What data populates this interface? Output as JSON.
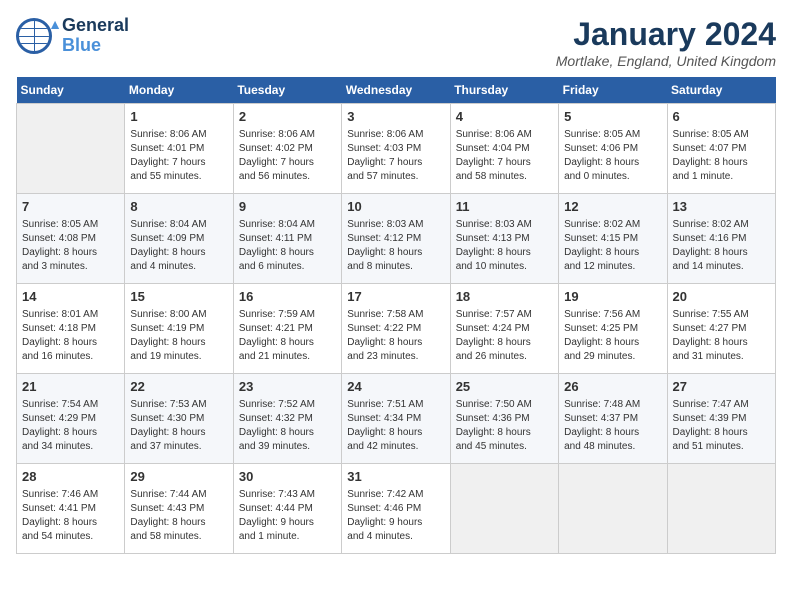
{
  "logo": {
    "general": "General",
    "blue": "Blue"
  },
  "header": {
    "title": "January 2024",
    "location": "Mortlake, England, United Kingdom"
  },
  "weekdays": [
    "Sunday",
    "Monday",
    "Tuesday",
    "Wednesday",
    "Thursday",
    "Friday",
    "Saturday"
  ],
  "weeks": [
    [
      {
        "day": "",
        "info": ""
      },
      {
        "day": "1",
        "info": "Sunrise: 8:06 AM\nSunset: 4:01 PM\nDaylight: 7 hours\nand 55 minutes."
      },
      {
        "day": "2",
        "info": "Sunrise: 8:06 AM\nSunset: 4:02 PM\nDaylight: 7 hours\nand 56 minutes."
      },
      {
        "day": "3",
        "info": "Sunrise: 8:06 AM\nSunset: 4:03 PM\nDaylight: 7 hours\nand 57 minutes."
      },
      {
        "day": "4",
        "info": "Sunrise: 8:06 AM\nSunset: 4:04 PM\nDaylight: 7 hours\nand 58 minutes."
      },
      {
        "day": "5",
        "info": "Sunrise: 8:05 AM\nSunset: 4:06 PM\nDaylight: 8 hours\nand 0 minutes."
      },
      {
        "day": "6",
        "info": "Sunrise: 8:05 AM\nSunset: 4:07 PM\nDaylight: 8 hours\nand 1 minute."
      }
    ],
    [
      {
        "day": "7",
        "info": "Sunrise: 8:05 AM\nSunset: 4:08 PM\nDaylight: 8 hours\nand 3 minutes."
      },
      {
        "day": "8",
        "info": "Sunrise: 8:04 AM\nSunset: 4:09 PM\nDaylight: 8 hours\nand 4 minutes."
      },
      {
        "day": "9",
        "info": "Sunrise: 8:04 AM\nSunset: 4:11 PM\nDaylight: 8 hours\nand 6 minutes."
      },
      {
        "day": "10",
        "info": "Sunrise: 8:03 AM\nSunset: 4:12 PM\nDaylight: 8 hours\nand 8 minutes."
      },
      {
        "day": "11",
        "info": "Sunrise: 8:03 AM\nSunset: 4:13 PM\nDaylight: 8 hours\nand 10 minutes."
      },
      {
        "day": "12",
        "info": "Sunrise: 8:02 AM\nSunset: 4:15 PM\nDaylight: 8 hours\nand 12 minutes."
      },
      {
        "day": "13",
        "info": "Sunrise: 8:02 AM\nSunset: 4:16 PM\nDaylight: 8 hours\nand 14 minutes."
      }
    ],
    [
      {
        "day": "14",
        "info": "Sunrise: 8:01 AM\nSunset: 4:18 PM\nDaylight: 8 hours\nand 16 minutes."
      },
      {
        "day": "15",
        "info": "Sunrise: 8:00 AM\nSunset: 4:19 PM\nDaylight: 8 hours\nand 19 minutes."
      },
      {
        "day": "16",
        "info": "Sunrise: 7:59 AM\nSunset: 4:21 PM\nDaylight: 8 hours\nand 21 minutes."
      },
      {
        "day": "17",
        "info": "Sunrise: 7:58 AM\nSunset: 4:22 PM\nDaylight: 8 hours\nand 23 minutes."
      },
      {
        "day": "18",
        "info": "Sunrise: 7:57 AM\nSunset: 4:24 PM\nDaylight: 8 hours\nand 26 minutes."
      },
      {
        "day": "19",
        "info": "Sunrise: 7:56 AM\nSunset: 4:25 PM\nDaylight: 8 hours\nand 29 minutes."
      },
      {
        "day": "20",
        "info": "Sunrise: 7:55 AM\nSunset: 4:27 PM\nDaylight: 8 hours\nand 31 minutes."
      }
    ],
    [
      {
        "day": "21",
        "info": "Sunrise: 7:54 AM\nSunset: 4:29 PM\nDaylight: 8 hours\nand 34 minutes."
      },
      {
        "day": "22",
        "info": "Sunrise: 7:53 AM\nSunset: 4:30 PM\nDaylight: 8 hours\nand 37 minutes."
      },
      {
        "day": "23",
        "info": "Sunrise: 7:52 AM\nSunset: 4:32 PM\nDaylight: 8 hours\nand 39 minutes."
      },
      {
        "day": "24",
        "info": "Sunrise: 7:51 AM\nSunset: 4:34 PM\nDaylight: 8 hours\nand 42 minutes."
      },
      {
        "day": "25",
        "info": "Sunrise: 7:50 AM\nSunset: 4:36 PM\nDaylight: 8 hours\nand 45 minutes."
      },
      {
        "day": "26",
        "info": "Sunrise: 7:48 AM\nSunset: 4:37 PM\nDaylight: 8 hours\nand 48 minutes."
      },
      {
        "day": "27",
        "info": "Sunrise: 7:47 AM\nSunset: 4:39 PM\nDaylight: 8 hours\nand 51 minutes."
      }
    ],
    [
      {
        "day": "28",
        "info": "Sunrise: 7:46 AM\nSunset: 4:41 PM\nDaylight: 8 hours\nand 54 minutes."
      },
      {
        "day": "29",
        "info": "Sunrise: 7:44 AM\nSunset: 4:43 PM\nDaylight: 8 hours\nand 58 minutes."
      },
      {
        "day": "30",
        "info": "Sunrise: 7:43 AM\nSunset: 4:44 PM\nDaylight: 9 hours\nand 1 minute."
      },
      {
        "day": "31",
        "info": "Sunrise: 7:42 AM\nSunset: 4:46 PM\nDaylight: 9 hours\nand 4 minutes."
      },
      {
        "day": "",
        "info": ""
      },
      {
        "day": "",
        "info": ""
      },
      {
        "day": "",
        "info": ""
      }
    ]
  ]
}
